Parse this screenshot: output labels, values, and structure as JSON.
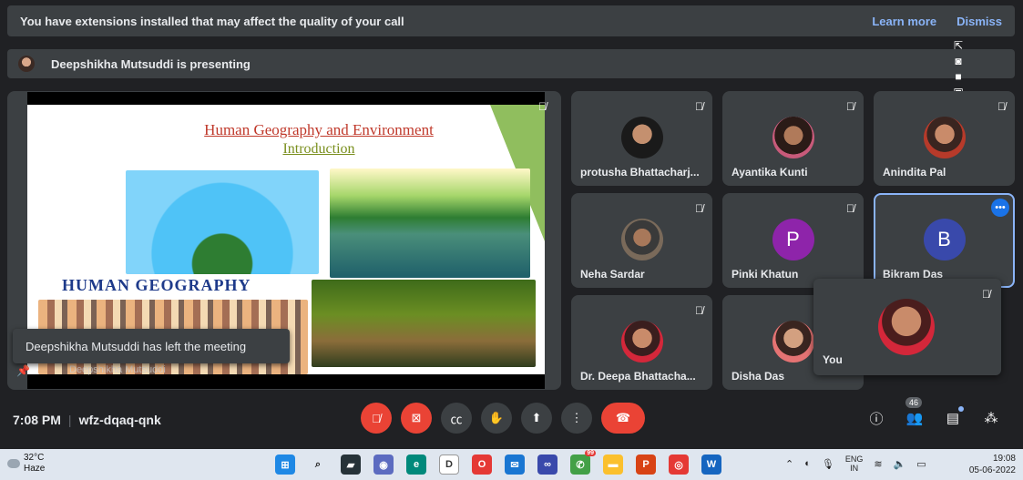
{
  "extension_banner": {
    "message": "You have extensions installed that may affect the quality of your call",
    "learn_more": "Learn more",
    "dismiss": "Dismiss"
  },
  "presenting_banner": {
    "text": "Deepshikha Mutsuddi is presenting"
  },
  "presentation": {
    "slide_title": "Human Geography and Environment",
    "slide_subtitle": "Introduction",
    "slide_banner_text": "HUMAN GEOGRAPHY",
    "presenter_name": "Deepshikha Mutsuddi"
  },
  "toast": {
    "message": "Deepshikha Mutsuddi has left the meeting"
  },
  "participants": [
    {
      "name": "protusha Bhattacharj...",
      "avatar": "photo",
      "muted": true
    },
    {
      "name": "Ayantika Kunti",
      "avatar": "photo",
      "muted": true
    },
    {
      "name": "Anindita Pal",
      "avatar": "photo",
      "muted": true
    },
    {
      "name": "Neha Sardar",
      "avatar": "photo",
      "muted": true
    },
    {
      "name": "Pinki Khatun",
      "avatar_letter": "P",
      "avatar_color": "#8e24aa",
      "muted": true
    },
    {
      "name": "Bikram Das",
      "avatar_letter": "B",
      "avatar_color": "#3949ab",
      "active": true
    },
    {
      "name": "Dr. Deepa Bhattacha...",
      "avatar": "photo",
      "muted": true
    },
    {
      "name": "Disha Das",
      "avatar": "photo",
      "muted": false
    }
  ],
  "self_view": {
    "name": "You"
  },
  "controls": {
    "time": "7:08 PM",
    "meeting_code": "wfz-dqaq-qnk",
    "people_count": "46"
  },
  "taskbar": {
    "temperature": "32°C",
    "weather": "Haze",
    "language_top": "ENG",
    "language_bottom": "IN",
    "time": "19:08",
    "date": "05-06-2022",
    "outlook_badge": "99"
  },
  "colors": {
    "background": "#202124",
    "tile": "#3c4043",
    "accent": "#8ab4f8",
    "end_call": "#ea4335"
  }
}
